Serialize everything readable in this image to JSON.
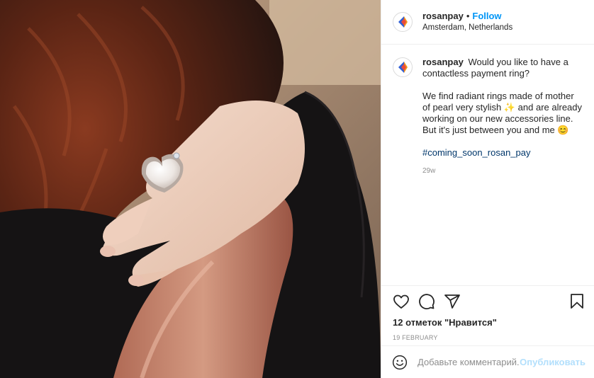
{
  "header": {
    "username": "rosanpay",
    "separator": "•",
    "follow_label": "Follow",
    "location": "Amsterdam, Netherlands"
  },
  "caption": {
    "username": "rosanpay",
    "paragraph1": "Would you like to have a contactless payment ring?",
    "paragraph2": "We find radiant rings made of mother of pearl very stylish ✨ and are already working on our new accessories line. But it's just between you and me 😊",
    "hashtag": "#coming_soon_rosan_pay",
    "age": "29w"
  },
  "actions": {
    "like_icon": "heart-icon",
    "comment_icon": "comment-icon",
    "share_icon": "share-icon",
    "save_icon": "bookmark-icon"
  },
  "likes_text": "12 отметок \"Нравится\"",
  "date": "19 FEBRUARY",
  "comment_box": {
    "emoji_icon": "smiley-icon",
    "placeholder": "Добавьте комментарий...",
    "publish_label": "Опубликовать"
  },
  "colors": {
    "follow": "#0095f6",
    "hashtag": "#00376b",
    "publish_disabled": "#b2dffc",
    "muted": "#8e8e8e"
  }
}
